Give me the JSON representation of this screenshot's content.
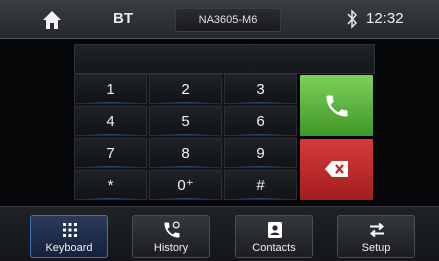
{
  "status_bar": {
    "source": "BT",
    "device_name": "NA3605-M6",
    "time": "12:32"
  },
  "keypad": {
    "keys": [
      {
        "label": "1"
      },
      {
        "label": "2"
      },
      {
        "label": "3"
      },
      {
        "label": "4"
      },
      {
        "label": "5"
      },
      {
        "label": "6"
      },
      {
        "label": "7"
      },
      {
        "label": "8"
      },
      {
        "label": "9"
      },
      {
        "label": "*"
      },
      {
        "label": "0⁺"
      },
      {
        "label": "#"
      }
    ]
  },
  "tabs": [
    {
      "label": "Keyboard",
      "icon": "grid-icon"
    },
    {
      "label": "History",
      "icon": "call-history-icon"
    },
    {
      "label": "Contacts",
      "icon": "contacts-icon"
    },
    {
      "label": "Setup",
      "icon": "swap-arrows-icon"
    }
  ],
  "colors": {
    "call": "#5db840",
    "delete": "#c42a2a",
    "accent": "#3a6dd8"
  }
}
